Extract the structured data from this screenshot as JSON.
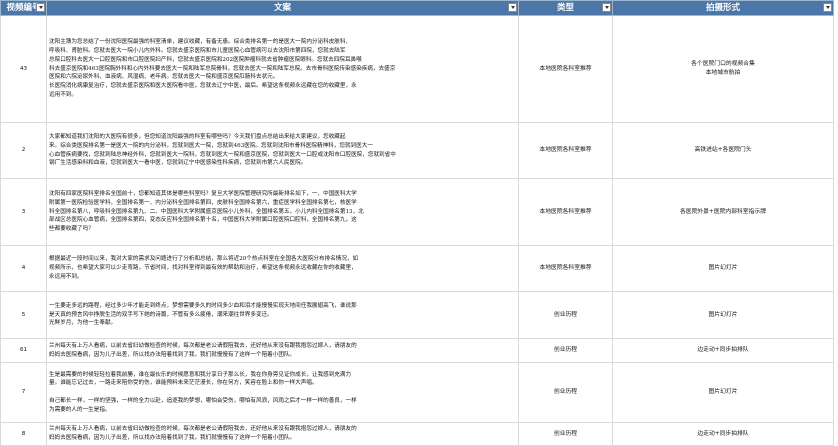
{
  "headers": {
    "id": "视频编号",
    "copy": "文案",
    "type": "类型",
    "format": "拍摄形式"
  },
  "rows": [
    {
      "id": "43",
      "copy": [
        "沈阳主簿为您总结了一份沈阳医院最强的科室清单，建议收藏，有备无患。综合类排名第一的是医大一院内分泌科皮肤科、",
        "呼吸科、肾脏科。您就去医大一院小儿内外科。您就去盛京医院和市儿童医院心血管病可以去沈阳市第四院，您就去陆军",
        "总院口腔科去医大一口腔医院和市口腔医院妇产科，您就去盛京医院和202医院肿瘤科就去省肿瘤医院眼科。您就去四院耳鼻喉",
        "科去盛京医院和463医院胸外科和心内外科要去医大一院和陆军总院骨科，您就去医大一院和陆军总院。去市骨科医院传染感染疾病，去盛京",
        "医院和六院泌尿外科、血液病、风湿病、老年病。您就去医大一院和盛京医院肛肠科去状元。",
        "长医院消化病康复治疗，您就去盛京医院和医大医院看中医，您就去辽宁中医，最后。希望这条视频永远藏在您的收藏里，永",
        "远用不到。"
      ],
      "type": "本地医院各科室推荐",
      "format": [
        "各个医院门口的视频合集",
        "本地城市航拍"
      ]
    },
    {
      "id": "2",
      "copy": [
        "大家都知道我们沈阳的大医院有很多，但您知道沈阳最强的科室有哪些吗？今天我们盘点总结出来给大家建议，您收藏起",
        "来。综合类医院排名第一是医大一院的内分泌科，您就到医大一院，您就到463医院。您就到沈阳市骨科医院精神科，您就到医大一",
        "心血管疾病要找，您就到陆总神经外科，您就到医大一院科，您就到医大一院和盛京医院，您就到医大一口腔或沈阳市口腔医院，您就到省中",
        "钢厂生活感染科和血液，您就到医大一看中医，您就到辽宁中医感染性科疾病，您就到市第六人民医院。"
      ],
      "type": "本地医院各科室推荐",
      "format": [
        "高铁进站+各医院门头"
      ]
    },
    {
      "id": "3",
      "copy": [
        "沈阳有四家医院科室排名全国前十，您都知道其体是哪些科室吗？复旦大学医院管理研究所最新排名如下，一、中国医科大学",
        "附属第一医院检验医学科，全国排名第一、内分泌科全国排名第四，皮肤科全国排名第六，重症医学科全国排名第七，核医学",
        "科全国排名第八，呼吸科全国排名第九、二、中国医科大学附属盛京医院小儿外科，全国排名第五，小儿内科全国排名第13，北",
        "部战区总医院心血管病，全国排名第四，变态反应科全国排名第十名，中国医科大学附属口腔医院口腔科，全国排名第九，这",
        "些都要收藏了吗？"
      ],
      "type": "本地医院各科室推荐",
      "format": [
        "各医院外景+医院内部科室指示牌"
      ]
    },
    {
      "id": "4",
      "copy": [
        "根据最近一段时间以来，我对大家的需求及问题进行了分析和总结，那么将近20个热点科室在全国各大医院分布排名情况，如",
        "视频所示，也希望大家可以少走弯路，节省时间，找对科室得到最有效的帮助和治疗，希望这条视频永远收藏在你的收藏里，",
        "永远用不到。"
      ],
      "type": "本地医院各科室推荐",
      "format": [
        "图片幻灯片"
      ]
    },
    {
      "id": "5",
      "copy": [
        "一生要走多远的路程，经过多少年才能走到终点，梦想需要多久的时间多少血和泪才能慢慢实现天地间任我展翅高飞，谁说那",
        "是天真的预言风中挣脱生活的双手写下她的诗篇，不管有多么疲倦，潮来潮往世界多变迁。",
        "光鲜岁月，为他一生奉献。"
      ],
      "type": "创业历程",
      "format": [
        "图片幻灯片"
      ]
    },
    {
      "id": "61",
      "copy": [
        "兰州每天有上万人看病，以前去省妇幼做检查的时候，每次都是老公请假陪我去，还好他从来没有跟我抱怨过嫁人，请朋友的",
        "妈妈去医院看病，因为儿子出差，所以找办法陪着找到了我，我们就慢慢有了这样一个陪着小团队。"
      ],
      "type": "创业历程",
      "format": [
        "边走动+同步拍排队"
      ]
    },
    {
      "id": "7",
      "copy": [
        "生是最需要的时候轻轻拉着我前勝，谁在最伙乐的时候愿意和我分享日子那么长，我在你身旁见证你成长，让我感到充满力",
        "量。谁能忘记过去，一路走来陪你受的伤，谁能预料未来茫茫漫长，你在何方，笑容在脸上和你一样大声唱。",
        "",
        "自己都长一样，一样的坚强，一样的全力以赴，追逐我的梦想，哪怕会受伤，哪怕有风浪，风雨之后才一样一样的善良，一样",
        "为需要的人的一生是指。"
      ],
      "type": "创业历程",
      "format": [
        "图片幻灯片"
      ]
    },
    {
      "id": "8",
      "copy": [
        "兰州每天有上万人看病，以前去省妇幼做检查的时候，每次都是老公请假陪我去，还好他从来没有跟我抱怨过嫁人，请朋友的",
        "妈妈去医院看病，因为儿子出差，所以找办法陪着找到了我，我们就慢慢有了这样一个陪着小团队。"
      ],
      "type": "创业历程",
      "format": [
        "边走动+同步拍排队"
      ]
    }
  ]
}
